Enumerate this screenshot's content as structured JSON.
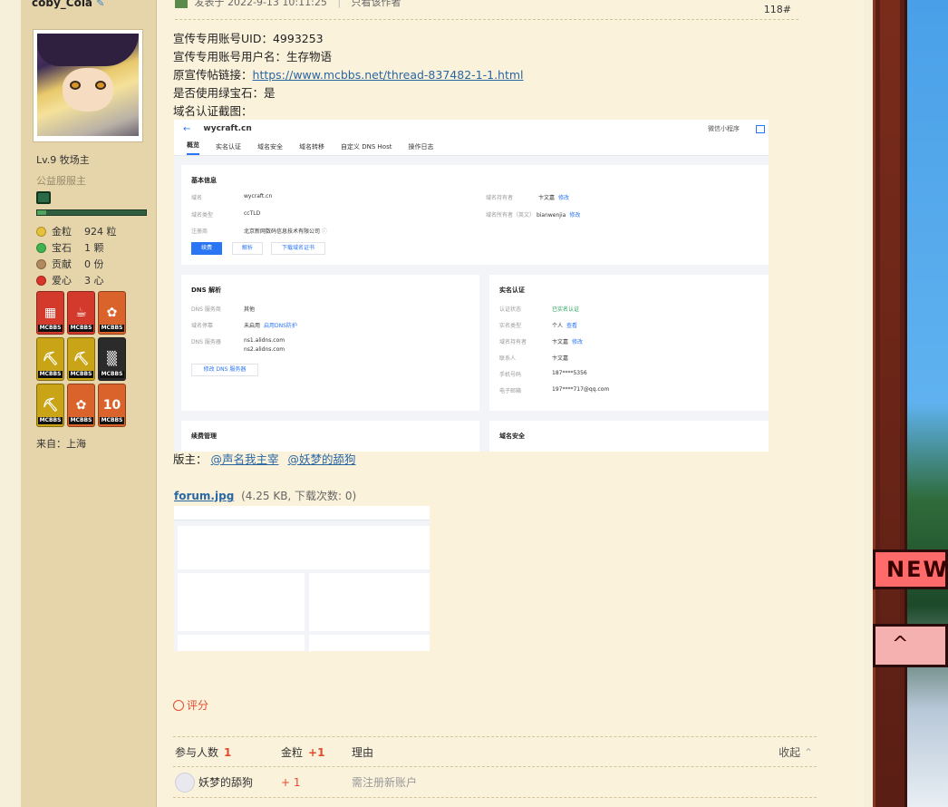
{
  "user": {
    "name": "coby_Cola",
    "level": "Lv.9 牧场主",
    "group": "公益服服主",
    "stats": [
      {
        "key": "金粒",
        "value": "924 粒",
        "color": "#e8c13a"
      },
      {
        "key": "宝石",
        "value": "1 颗",
        "color": "#3fb34f"
      },
      {
        "key": "贡献",
        "value": "0 份",
        "color": "#b08a5c"
      },
      {
        "key": "爱心",
        "value": "3 心",
        "color": "#d9342b"
      }
    ],
    "medals": [
      {
        "tag": "MCBBS",
        "color": "#d33a2c",
        "glyph": "▦"
      },
      {
        "tag": "MCBBS",
        "color": "#d33a2c",
        "glyph": "☕"
      },
      {
        "tag": "MCBBS",
        "color": "#d9632a",
        "glyph": "✿"
      },
      {
        "tag": "MCBBS",
        "color": "#c9a417",
        "glyph": "⛏"
      },
      {
        "tag": "MCBBS",
        "color": "#c9a417",
        "glyph": "⛏"
      },
      {
        "tag": "MCBBS",
        "color": "#2b2b2b",
        "glyph": "▒"
      },
      {
        "tag": "MCBBS",
        "color": "#c9a417",
        "glyph": "⛏"
      },
      {
        "tag": "MCBBS",
        "color": "#d9632a",
        "glyph": "✿"
      },
      {
        "tag": "MCBBS",
        "color": "#d9632a",
        "glyph": "10"
      }
    ],
    "from": "来自：上海"
  },
  "post": {
    "posted_at": "发表于 2022-9-13 10:11:25",
    "only_author": "只看该作者",
    "floor": "118#",
    "lines": {
      "uid": "宣传专用账号UID：4993253",
      "username": "宣传专用账号用户名：生存物语",
      "link_label": "原宣传帖链接：",
      "link": "https://www.mcbbs.net/thread-837482-1-1.html",
      "gem": "是否使用绿宝石：是",
      "screenshot_label": "域名认证截图："
    },
    "moderators_label": "版主：",
    "moderators": [
      "@声名我主宰",
      "@妖梦的舔狗"
    ],
    "attachment": {
      "name": "forum.jpg",
      "meta": "(4.25 KB, 下载次数: 0)"
    }
  },
  "screenshot": {
    "domain": "wycraft.cn",
    "mini_program": "微信小程序",
    "tabs": [
      "概览",
      "实名认证",
      "域名安全",
      "域名转移",
      "自定义 DNS Host",
      "操作日志"
    ],
    "basic": {
      "title": "基本信息",
      "domain_label": "域名",
      "domain_value": "wycraft.cn",
      "type_label": "域名类型",
      "type_value": "ccTLD",
      "registrar_label": "注册商",
      "registrar_value": "北京新网数码信息技术有限公司",
      "holder_label": "域名持有者",
      "holder_value": "卞文嘉",
      "holder_en_label": "域名所有者（英文）",
      "holder_en_value": "bianwenjia",
      "edit": "修改",
      "btn_renew": "续费",
      "btn_resolve": "解析",
      "btn_cert": "下载域名证书"
    },
    "dns": {
      "title": "DNS 解析",
      "provider_label": "DNS 服务商",
      "provider_value": "其他",
      "status_label": "域名停靠",
      "status_value": "未启用",
      "status_link": "启用DNS防护",
      "server_label": "DNS 服务器",
      "server_1": "ns1.alidns.com",
      "server_2": "ns2.alidns.com",
      "btn_edit": "修改 DNS 服务器"
    },
    "realname": {
      "title": "实名认证",
      "status_label": "认证状态",
      "status_value": "已实名认证",
      "type_label": "实名类型",
      "type_value": "个人",
      "holder_label": "域名持有者",
      "holder_value": "卞文嘉",
      "contact_label": "联系人",
      "contact_value": "卞文嘉",
      "phone_label": "手机号码",
      "phone_value": "187****5356",
      "email_label": "电子邮箱",
      "email_value": "197****717@qq.com",
      "view": "查看",
      "edit": "修改"
    },
    "renew": {
      "title": "续费管理"
    },
    "security": {
      "title": "域名安全"
    }
  },
  "rating": {
    "label": "评分",
    "participants_label": "参与人数",
    "participants": "1",
    "gold_label": "金粒",
    "gold_total": "+1",
    "reason_label": "理由",
    "collapse": "收起",
    "rows": [
      {
        "user": "妖梦的舔狗",
        "gold": "+ 1",
        "reason": "需注册新账户"
      }
    ]
  },
  "decor": {
    "new_tag": "NEW",
    "up_tag": "^"
  }
}
